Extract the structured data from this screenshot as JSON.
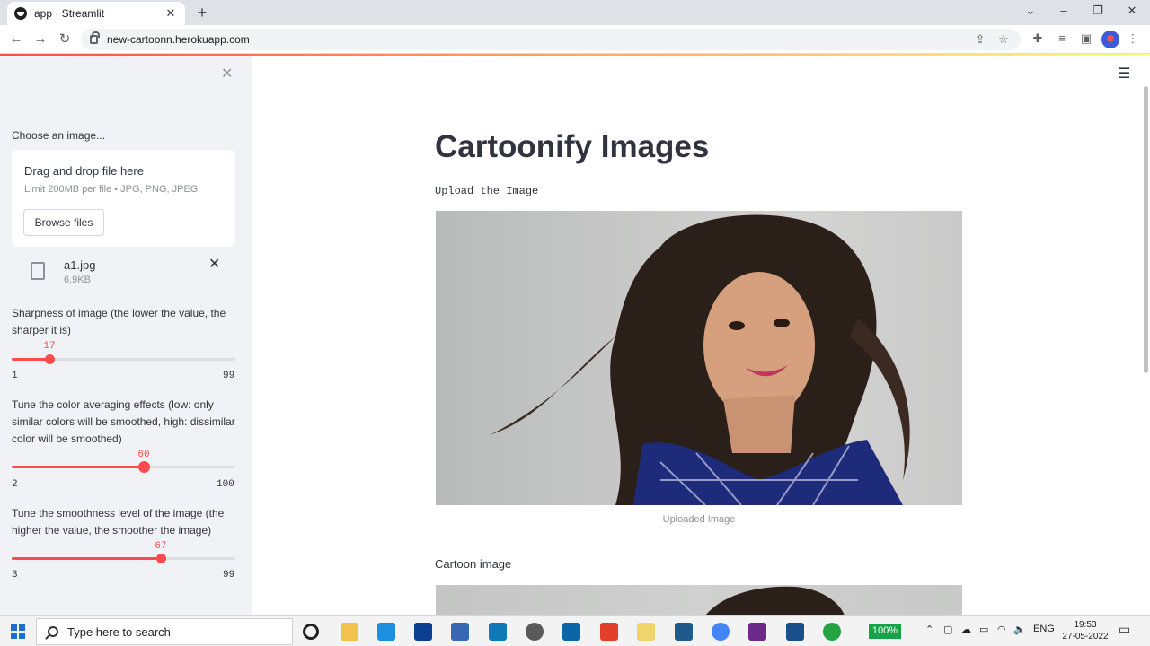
{
  "browser": {
    "tab_title": "app · Streamlit",
    "url": "new-cartoonn.herokuapp.com"
  },
  "sidebar": {
    "uploader_label": "Choose an image...",
    "dropzone_title": "Drag and drop file here",
    "dropzone_limit": "Limit 200MB per file • JPG, PNG, JPEG",
    "browse_label": "Browse files",
    "file_name": "a1.jpg",
    "file_size": "6.9KB",
    "sliders": [
      {
        "label": "Sharpness of image (the lower the value, the sharper it is)",
        "value": "17",
        "min": "1",
        "max": "99",
        "fraction": 0.167
      },
      {
        "label": "Tune the color averaging effects (low: only similar colors will be smoothed, high: dissimilar color will be smoothed)",
        "value": "60",
        "min": "2",
        "max": "100",
        "fraction": 0.592
      },
      {
        "label": "Tune the smoothness level of the image (the higher the value, the smoother the image)",
        "value": "67",
        "min": "3",
        "max": "99",
        "fraction": 0.667
      }
    ]
  },
  "main": {
    "title": "Cartoonify Images",
    "upload_text": "Upload the Image",
    "caption": "Uploaded Image",
    "cartoon_label": "Cartoon image"
  },
  "taskbar": {
    "search_placeholder": "Type here to search",
    "battery": "100%",
    "language": "ENG",
    "time": "19:53",
    "date": "27-05-2022"
  },
  "colors": {
    "accent": "#ff4b4b",
    "sidebar_bg": "#f0f2f6",
    "text": "#31333f"
  }
}
